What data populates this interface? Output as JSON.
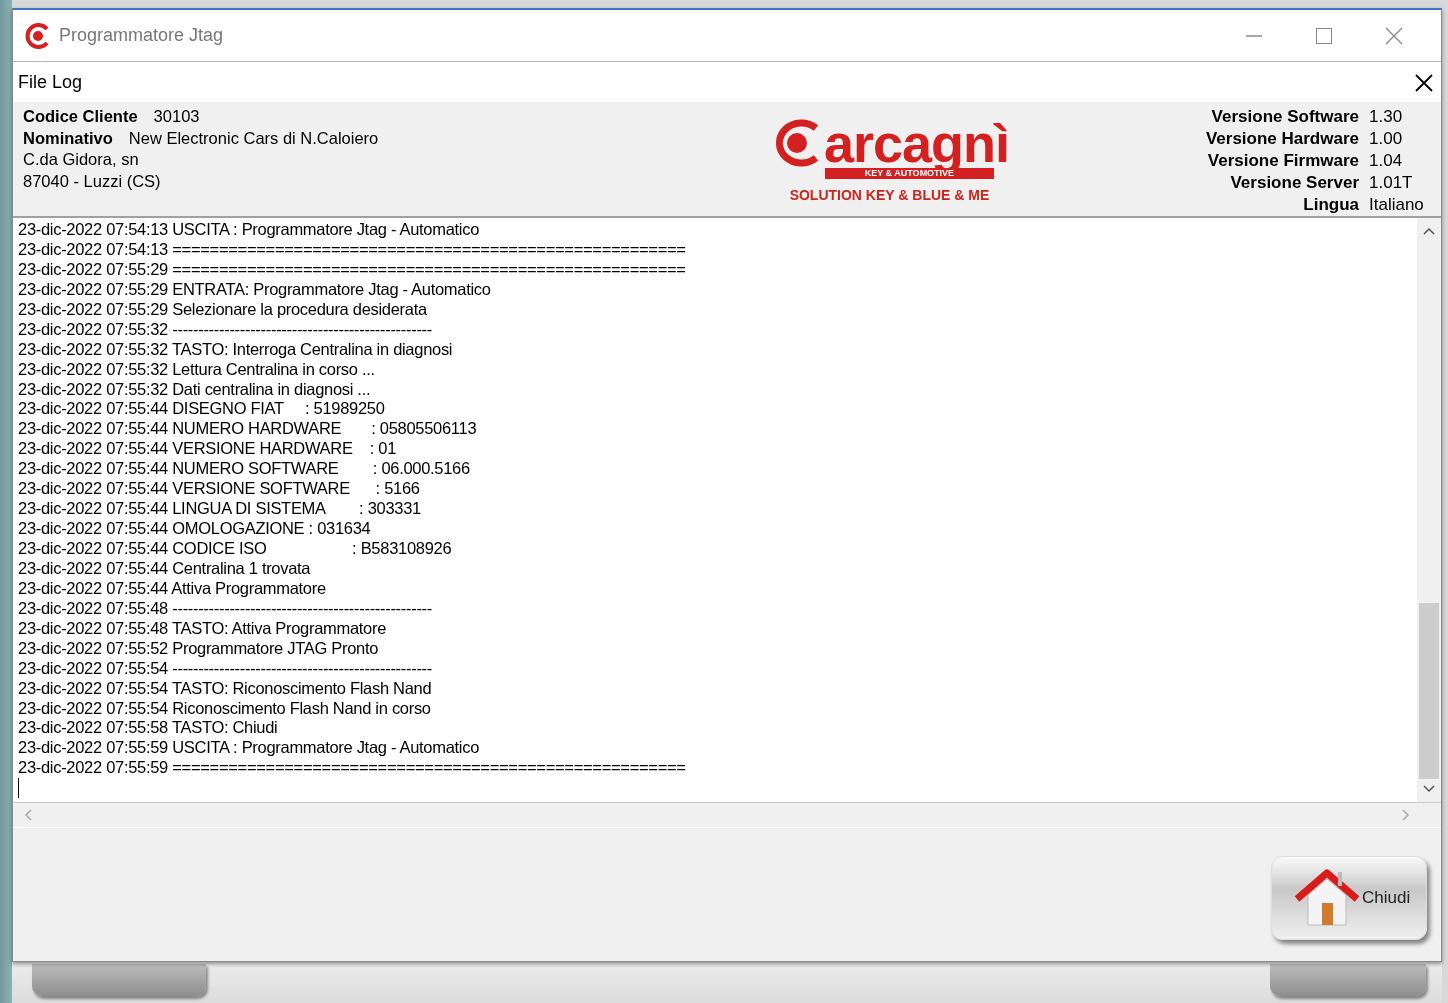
{
  "window": {
    "title": "Programmatore Jtag"
  },
  "dialog": {
    "title": "File Log"
  },
  "customer": {
    "code_label": "Codice Cliente",
    "code": "30103",
    "name_label": "Nominativo",
    "name": "New Electronic Cars di N.Caloiero",
    "address_lines": [
      "C.da Gidora, sn",
      "87040 - Luzzi (CS)"
    ]
  },
  "logo": {
    "wordmark": "arcagnì",
    "tagline": "KEY & AUTOMOTIVE",
    "slogan": "SOLUTION KEY & BLUE & ME"
  },
  "versions": [
    {
      "label": "Versione Software",
      "value": "1.30"
    },
    {
      "label": "Versione Hardware",
      "value": "1.00"
    },
    {
      "label": "Versione Firmware",
      "value": "1.04"
    },
    {
      "label": "Versione Server",
      "value": "1.01T"
    },
    {
      "label": "Lingua",
      "value": "Italiano"
    }
  ],
  "log_lines": [
    "23-dic-2022 07:54:13 USCITA : Programmatore Jtag - Automatico",
    "23-dic-2022 07:54:13 =======================================================",
    "23-dic-2022 07:55:29 =======================================================",
    "23-dic-2022 07:55:29 ENTRATA: Programmatore Jtag - Automatico",
    "23-dic-2022 07:55:29 Selezionare la procedura desiderata",
    "23-dic-2022 07:55:32 --------------------------------------------------",
    "23-dic-2022 07:55:32 TASTO: Interroga Centralina in diagnosi",
    "23-dic-2022 07:55:32 Lettura Centralina in corso ...",
    "23-dic-2022 07:55:32 Dati centralina in diagnosi ...",
    "23-dic-2022 07:55:44 DISEGNO FIAT     : 51989250",
    "23-dic-2022 07:55:44 NUMERO HARDWARE       : 05805506113",
    "23-dic-2022 07:55:44 VERSIONE HARDWARE    : 01",
    "23-dic-2022 07:55:44 NUMERO SOFTWARE        : 06.000.5166",
    "23-dic-2022 07:55:44 VERSIONE SOFTWARE      : 5166",
    "23-dic-2022 07:55:44 LINGUA DI SISTEMA        : 303331",
    "23-dic-2022 07:55:44 OMOLOGAZIONE : 031634",
    "23-dic-2022 07:55:44 CODICE ISO                    : B583108926",
    "23-dic-2022 07:55:44 Centralina 1 trovata",
    "23-dic-2022 07:55:44 Attiva Programmatore",
    "23-dic-2022 07:55:48 --------------------------------------------------",
    "23-dic-2022 07:55:48 TASTO: Attiva Programmatore",
    "23-dic-2022 07:55:52 Programmatore JTAG Pronto",
    "23-dic-2022 07:55:54 --------------------------------------------------",
    "23-dic-2022 07:55:54 TASTO: Riconoscimento Flash Nand",
    "23-dic-2022 07:55:54 Riconoscimento Flash Nand in corso",
    "23-dic-2022 07:55:58 TASTO: Chiudi",
    "23-dic-2022 07:55:59 USCITA : Programmatore Jtag - Automatico",
    "23-dic-2022 07:55:59 ======================================================="
  ],
  "close_button": {
    "label": "Chiudi"
  }
}
